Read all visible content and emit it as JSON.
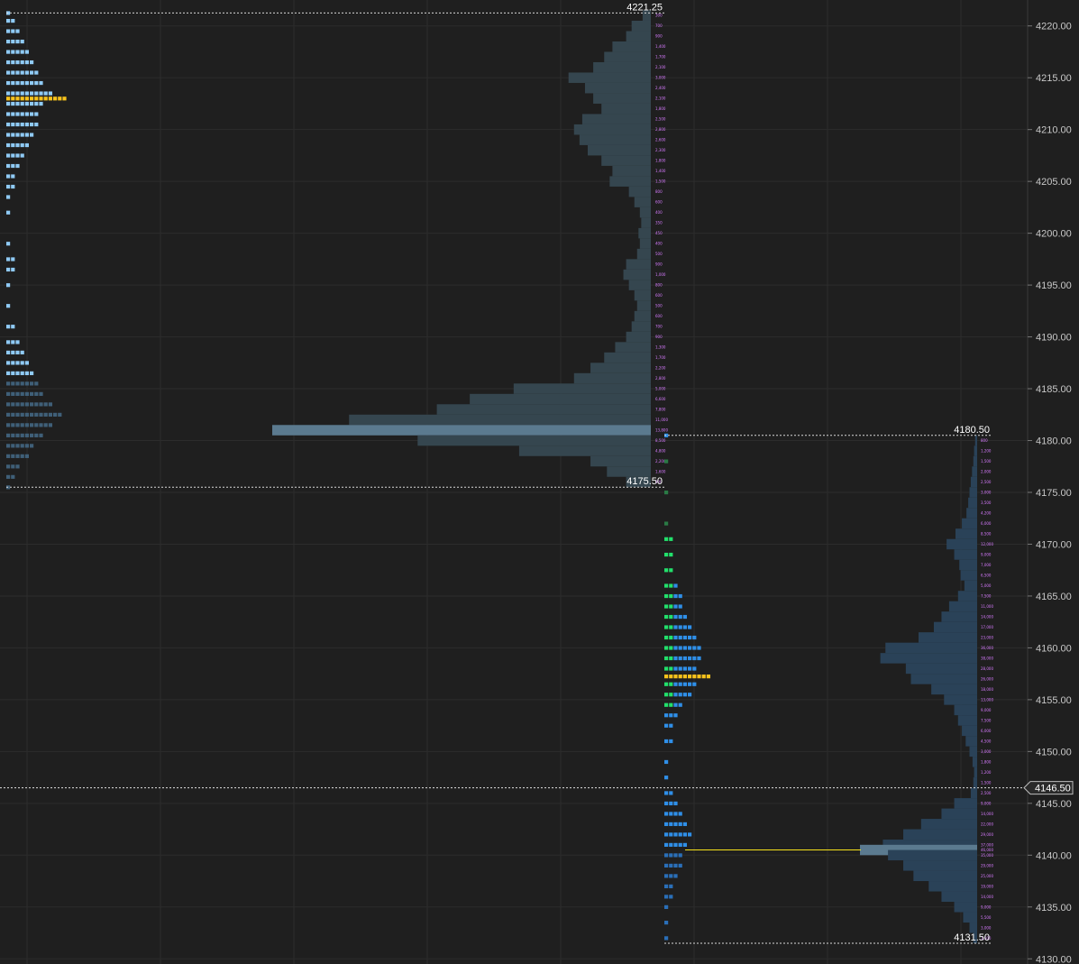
{
  "colors": {
    "background": "#1f1f1f",
    "grid": "#2c2c2c",
    "axis_text": "#c8c8c8",
    "tpo_session1": "#8fcaf5",
    "tpo_session1_early": "#3f5f78",
    "tpo_session2_ib": "#22e06b",
    "tpo_session2": "#2f8fe8",
    "tpo_session2_late": "#2a6fb8",
    "poc_marker": "#f7c21b",
    "volume_profile_1": "#35464f",
    "volume_profile_2": "#2a4258",
    "volume_poc": "#5b7a8f",
    "volume_labels": "#d77bff",
    "current_price_line": "#ffffff",
    "poc_line": "#f7e21b"
  },
  "chart_data": {
    "type": "market-profile",
    "tick_size": 0.25,
    "y_axis": {
      "min": 4129.5,
      "max": 4222.5,
      "ticks": [
        "4130.00",
        "4135.00",
        "4140.00",
        "4145.00",
        "4150.00",
        "4155.00",
        "4160.00",
        "4165.00",
        "4170.00",
        "4175.00",
        "4180.00",
        "4185.00",
        "4190.00",
        "4195.00",
        "4200.00",
        "4205.00",
        "4210.00",
        "4215.00",
        "4220.00"
      ]
    },
    "current_price": {
      "value": 4146.5,
      "label": "4146.50"
    },
    "sessions": [
      {
        "name": "",
        "high": 4221.25,
        "high_label": "4221.25",
        "low": 4175.5,
        "low_label": "4175.50",
        "tpo_poc": 4213.0,
        "volume_poc": 4181.0,
        "tpo_counts": [
          [
            4221.25,
            1
          ],
          [
            4220.5,
            2
          ],
          [
            4219.5,
            3
          ],
          [
            4218.5,
            4
          ],
          [
            4217.5,
            5
          ],
          [
            4216.5,
            6
          ],
          [
            4215.5,
            7
          ],
          [
            4214.5,
            8
          ],
          [
            4213.5,
            10
          ],
          [
            4213.0,
            13
          ],
          [
            4212.5,
            8
          ],
          [
            4211.5,
            7
          ],
          [
            4210.5,
            7
          ],
          [
            4209.5,
            6
          ],
          [
            4208.5,
            5
          ],
          [
            4207.5,
            4
          ],
          [
            4206.5,
            3
          ],
          [
            4205.5,
            2
          ],
          [
            4204.5,
            2
          ],
          [
            4203.5,
            1
          ],
          [
            4202.0,
            1
          ],
          [
            4199.0,
            1
          ],
          [
            4197.5,
            2
          ],
          [
            4196.5,
            2
          ],
          [
            4195.0,
            1
          ],
          [
            4193.0,
            1
          ],
          [
            4191.0,
            2
          ],
          [
            4189.5,
            3
          ],
          [
            4188.5,
            4
          ],
          [
            4187.5,
            5
          ],
          [
            4186.5,
            6
          ],
          [
            4185.5,
            7
          ],
          [
            4184.5,
            8
          ],
          [
            4183.5,
            10
          ],
          [
            4182.5,
            12
          ],
          [
            4181.5,
            10
          ],
          [
            4180.5,
            8
          ],
          [
            4179.5,
            6
          ],
          [
            4178.5,
            5
          ],
          [
            4177.5,
            3
          ],
          [
            4176.5,
            2
          ],
          [
            4175.5,
            1
          ]
        ],
        "volumes": [
          [
            4221.0,
            300
          ],
          [
            4220.0,
            700
          ],
          [
            4219.0,
            900
          ],
          [
            4218.0,
            1400
          ],
          [
            4217.0,
            1700
          ],
          [
            4216.0,
            2100
          ],
          [
            4215.0,
            3000
          ],
          [
            4214.0,
            2400
          ],
          [
            4213.0,
            2100
          ],
          [
            4212.0,
            1800
          ],
          [
            4211.0,
            2500
          ],
          [
            4210.0,
            2800
          ],
          [
            4209.0,
            2600
          ],
          [
            4208.0,
            2300
          ],
          [
            4207.0,
            1800
          ],
          [
            4206.0,
            1400
          ],
          [
            4205.0,
            1500
          ],
          [
            4204.0,
            800
          ],
          [
            4203.0,
            600
          ],
          [
            4202.0,
            400
          ],
          [
            4201.0,
            350
          ],
          [
            4200.0,
            450
          ],
          [
            4199.0,
            400
          ],
          [
            4198.0,
            500
          ],
          [
            4197.0,
            900
          ],
          [
            4196.0,
            1000
          ],
          [
            4195.0,
            800
          ],
          [
            4194.0,
            600
          ],
          [
            4193.0,
            500
          ],
          [
            4192.0,
            600
          ],
          [
            4191.0,
            700
          ],
          [
            4190.0,
            900
          ],
          [
            4189.0,
            1300
          ],
          [
            4188.0,
            1700
          ],
          [
            4187.0,
            2200
          ],
          [
            4186.0,
            2800
          ],
          [
            4185.0,
            5000
          ],
          [
            4184.0,
            6600
          ],
          [
            4183.0,
            7800
          ],
          [
            4182.0,
            11000
          ],
          [
            4181.0,
            13800
          ],
          [
            4180.0,
            8500
          ],
          [
            4179.0,
            4800
          ],
          [
            4178.0,
            2200
          ],
          [
            4177.0,
            1600
          ],
          [
            4176.0,
            900
          ]
        ]
      },
      {
        "name": "",
        "high": 4180.5,
        "high_label": "4180.50",
        "low": 4131.5,
        "low_label": "4131.50",
        "tpo_poc": 4157.25,
        "volume_poc": 4140.5,
        "tpo_counts": [
          [
            4180.5,
            1
          ],
          [
            4178.0,
            1
          ],
          [
            4175.0,
            1
          ],
          [
            4172.0,
            1
          ],
          [
            4170.5,
            2
          ],
          [
            4169.0,
            2
          ],
          [
            4167.5,
            2
          ],
          [
            4166.0,
            3
          ],
          [
            4165.0,
            4
          ],
          [
            4164.0,
            4
          ],
          [
            4163.0,
            5
          ],
          [
            4162.0,
            6
          ],
          [
            4161.0,
            7
          ],
          [
            4160.0,
            8
          ],
          [
            4159.0,
            8
          ],
          [
            4158.0,
            7
          ],
          [
            4157.25,
            10
          ],
          [
            4156.5,
            7
          ],
          [
            4155.5,
            6
          ],
          [
            4154.5,
            4
          ],
          [
            4153.5,
            3
          ],
          [
            4152.5,
            2
          ],
          [
            4151.0,
            2
          ],
          [
            4149.0,
            1
          ],
          [
            4147.5,
            1
          ],
          [
            4146.0,
            2
          ],
          [
            4145.0,
            3
          ],
          [
            4144.0,
            4
          ],
          [
            4143.0,
            5
          ],
          [
            4142.0,
            6
          ],
          [
            4141.0,
            5
          ],
          [
            4140.0,
            4
          ],
          [
            4139.0,
            4
          ],
          [
            4138.0,
            3
          ],
          [
            4137.0,
            2
          ],
          [
            4136.0,
            2
          ],
          [
            4135.0,
            1
          ],
          [
            4133.5,
            1
          ],
          [
            4132.0,
            1
          ]
        ],
        "volumes": [
          [
            4180.0,
            800
          ],
          [
            4179.0,
            1200
          ],
          [
            4178.0,
            1500
          ],
          [
            4177.0,
            2000
          ],
          [
            4176.0,
            2500
          ],
          [
            4175.0,
            3000
          ],
          [
            4174.0,
            3500
          ],
          [
            4173.0,
            4200
          ],
          [
            4172.0,
            6000
          ],
          [
            4171.0,
            8500
          ],
          [
            4170.0,
            12000
          ],
          [
            4169.0,
            9000
          ],
          [
            4168.0,
            7000
          ],
          [
            4167.0,
            6500
          ],
          [
            4166.0,
            5000
          ],
          [
            4165.0,
            7500
          ],
          [
            4164.0,
            11000
          ],
          [
            4163.0,
            14000
          ],
          [
            4162.0,
            17000
          ],
          [
            4161.0,
            23000
          ],
          [
            4160.0,
            36000
          ],
          [
            4159.0,
            38000
          ],
          [
            4158.0,
            28000
          ],
          [
            4157.0,
            26000
          ],
          [
            4156.0,
            18000
          ],
          [
            4155.0,
            13000
          ],
          [
            4154.0,
            9000
          ],
          [
            4153.0,
            7500
          ],
          [
            4152.0,
            6000
          ],
          [
            4151.0,
            4500
          ],
          [
            4150.0,
            3000
          ],
          [
            4149.0,
            1800
          ],
          [
            4148.0,
            1200
          ],
          [
            4147.0,
            1500
          ],
          [
            4146.0,
            2500
          ],
          [
            4145.0,
            9000
          ],
          [
            4144.0,
            14000
          ],
          [
            4143.0,
            22000
          ],
          [
            4142.0,
            29000
          ],
          [
            4141.0,
            37000
          ],
          [
            4140.5,
            46000
          ],
          [
            4140.0,
            35000
          ],
          [
            4139.0,
            29000
          ],
          [
            4138.0,
            25000
          ],
          [
            4137.0,
            19000
          ],
          [
            4136.0,
            14000
          ],
          [
            4135.0,
            9000
          ],
          [
            4134.0,
            5500
          ],
          [
            4133.0,
            3000
          ],
          [
            4132.0,
            1500
          ]
        ]
      }
    ]
  }
}
